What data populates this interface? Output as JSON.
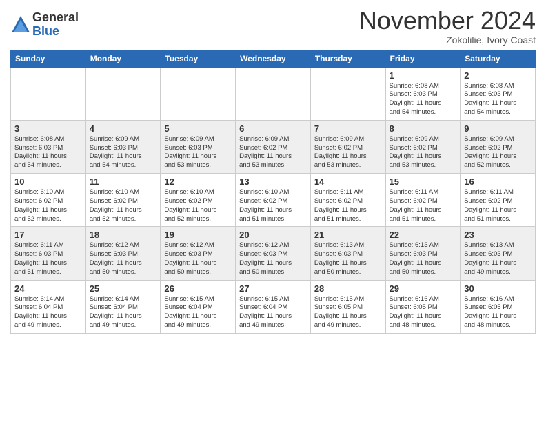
{
  "logo": {
    "general": "General",
    "blue": "Blue"
  },
  "title": "November 2024",
  "location": "Zokolilie, Ivory Coast",
  "days_of_week": [
    "Sunday",
    "Monday",
    "Tuesday",
    "Wednesday",
    "Thursday",
    "Friday",
    "Saturday"
  ],
  "weeks": [
    {
      "week": 1,
      "days": [
        {
          "number": "",
          "info": ""
        },
        {
          "number": "",
          "info": ""
        },
        {
          "number": "",
          "info": ""
        },
        {
          "number": "",
          "info": ""
        },
        {
          "number": "",
          "info": ""
        },
        {
          "number": "1",
          "info": "Sunrise: 6:08 AM\nSunset: 6:03 PM\nDaylight: 11 hours\nand 54 minutes."
        },
        {
          "number": "2",
          "info": "Sunrise: 6:08 AM\nSunset: 6:03 PM\nDaylight: 11 hours\nand 54 minutes."
        }
      ]
    },
    {
      "week": 2,
      "days": [
        {
          "number": "3",
          "info": "Sunrise: 6:08 AM\nSunset: 6:03 PM\nDaylight: 11 hours\nand 54 minutes."
        },
        {
          "number": "4",
          "info": "Sunrise: 6:09 AM\nSunset: 6:03 PM\nDaylight: 11 hours\nand 54 minutes."
        },
        {
          "number": "5",
          "info": "Sunrise: 6:09 AM\nSunset: 6:03 PM\nDaylight: 11 hours\nand 53 minutes."
        },
        {
          "number": "6",
          "info": "Sunrise: 6:09 AM\nSunset: 6:02 PM\nDaylight: 11 hours\nand 53 minutes."
        },
        {
          "number": "7",
          "info": "Sunrise: 6:09 AM\nSunset: 6:02 PM\nDaylight: 11 hours\nand 53 minutes."
        },
        {
          "number": "8",
          "info": "Sunrise: 6:09 AM\nSunset: 6:02 PM\nDaylight: 11 hours\nand 53 minutes."
        },
        {
          "number": "9",
          "info": "Sunrise: 6:09 AM\nSunset: 6:02 PM\nDaylight: 11 hours\nand 52 minutes."
        }
      ]
    },
    {
      "week": 3,
      "days": [
        {
          "number": "10",
          "info": "Sunrise: 6:10 AM\nSunset: 6:02 PM\nDaylight: 11 hours\nand 52 minutes."
        },
        {
          "number": "11",
          "info": "Sunrise: 6:10 AM\nSunset: 6:02 PM\nDaylight: 11 hours\nand 52 minutes."
        },
        {
          "number": "12",
          "info": "Sunrise: 6:10 AM\nSunset: 6:02 PM\nDaylight: 11 hours\nand 52 minutes."
        },
        {
          "number": "13",
          "info": "Sunrise: 6:10 AM\nSunset: 6:02 PM\nDaylight: 11 hours\nand 51 minutes."
        },
        {
          "number": "14",
          "info": "Sunrise: 6:11 AM\nSunset: 6:02 PM\nDaylight: 11 hours\nand 51 minutes."
        },
        {
          "number": "15",
          "info": "Sunrise: 6:11 AM\nSunset: 6:02 PM\nDaylight: 11 hours\nand 51 minutes."
        },
        {
          "number": "16",
          "info": "Sunrise: 6:11 AM\nSunset: 6:02 PM\nDaylight: 11 hours\nand 51 minutes."
        }
      ]
    },
    {
      "week": 4,
      "days": [
        {
          "number": "17",
          "info": "Sunrise: 6:11 AM\nSunset: 6:03 PM\nDaylight: 11 hours\nand 51 minutes."
        },
        {
          "number": "18",
          "info": "Sunrise: 6:12 AM\nSunset: 6:03 PM\nDaylight: 11 hours\nand 50 minutes."
        },
        {
          "number": "19",
          "info": "Sunrise: 6:12 AM\nSunset: 6:03 PM\nDaylight: 11 hours\nand 50 minutes."
        },
        {
          "number": "20",
          "info": "Sunrise: 6:12 AM\nSunset: 6:03 PM\nDaylight: 11 hours\nand 50 minutes."
        },
        {
          "number": "21",
          "info": "Sunrise: 6:13 AM\nSunset: 6:03 PM\nDaylight: 11 hours\nand 50 minutes."
        },
        {
          "number": "22",
          "info": "Sunrise: 6:13 AM\nSunset: 6:03 PM\nDaylight: 11 hours\nand 50 minutes."
        },
        {
          "number": "23",
          "info": "Sunrise: 6:13 AM\nSunset: 6:03 PM\nDaylight: 11 hours\nand 49 minutes."
        }
      ]
    },
    {
      "week": 5,
      "days": [
        {
          "number": "24",
          "info": "Sunrise: 6:14 AM\nSunset: 6:04 PM\nDaylight: 11 hours\nand 49 minutes."
        },
        {
          "number": "25",
          "info": "Sunrise: 6:14 AM\nSunset: 6:04 PM\nDaylight: 11 hours\nand 49 minutes."
        },
        {
          "number": "26",
          "info": "Sunrise: 6:15 AM\nSunset: 6:04 PM\nDaylight: 11 hours\nand 49 minutes."
        },
        {
          "number": "27",
          "info": "Sunrise: 6:15 AM\nSunset: 6:04 PM\nDaylight: 11 hours\nand 49 minutes."
        },
        {
          "number": "28",
          "info": "Sunrise: 6:15 AM\nSunset: 6:05 PM\nDaylight: 11 hours\nand 49 minutes."
        },
        {
          "number": "29",
          "info": "Sunrise: 6:16 AM\nSunset: 6:05 PM\nDaylight: 11 hours\nand 48 minutes."
        },
        {
          "number": "30",
          "info": "Sunrise: 6:16 AM\nSunset: 6:05 PM\nDaylight: 11 hours\nand 48 minutes."
        }
      ]
    }
  ]
}
